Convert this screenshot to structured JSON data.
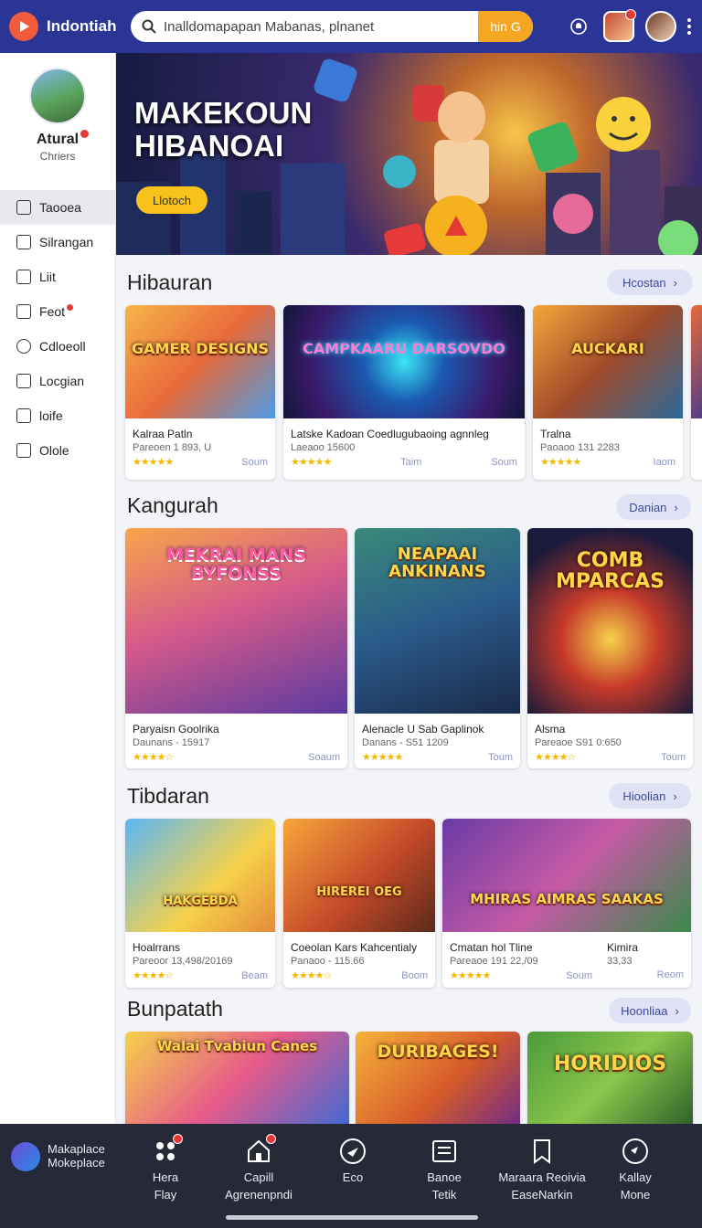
{
  "header": {
    "brand": "Indontiah",
    "search_placeholder": "Inalldomapapan Mabanas, plnanet",
    "search_button": "hin G"
  },
  "sidebar": {
    "profile_name": "Atural",
    "profile_sub": "Chriers",
    "items": [
      {
        "label": "Taooea"
      },
      {
        "label": "Silrangan"
      },
      {
        "label": "Liit"
      },
      {
        "label": "Feot"
      },
      {
        "label": "Cdloeoll"
      },
      {
        "label": "Locgian"
      },
      {
        "label": "loife"
      },
      {
        "label": "Olole"
      }
    ]
  },
  "hero": {
    "title": "MAKEKOUN HIBANOAI",
    "button": "Llotoch"
  },
  "sections": [
    {
      "title": "Hibauran",
      "more": "Hcostan",
      "cards": [
        {
          "image_text": "GAMER DESIGNS",
          "title": "Kalraa Patln",
          "sub": "Pareoen 1 893, U",
          "action": "Soum"
        },
        {
          "image_text": "CAMPKAARU DARSOVDO",
          "title": "Latske Kadoan Coedlugubaoing agnnleg",
          "sub": "Laeaoo 15600",
          "action": "Taim",
          "action2": "Soum"
        },
        {
          "image_text": "AUCKARI",
          "title": "Tralna",
          "sub": "Paoaoo 131 2283",
          "action": "Iaom"
        }
      ]
    },
    {
      "title": "Kangurah",
      "more": "Danian",
      "cards": [
        {
          "image_text": "MEKRAI MANS BYFONSS",
          "title": "Paryaisn Goolrika",
          "sub": "Daunans - 15917",
          "action": "Soaum"
        },
        {
          "image_text": "NEAPAAI ANKINANS",
          "title": "Alenacle U Sab Gaplinok",
          "sub": "Danans - S51 1209",
          "action": "Toum"
        },
        {
          "image_text": "COMB MPARCAS",
          "title": "Alsma",
          "sub": "Pareaoe S91 0:650",
          "action": "Toum"
        }
      ]
    },
    {
      "title": "Tibdaran",
      "more": "Hioolian",
      "cards": [
        {
          "image_text": "HAKGEBDA",
          "title": "Hoalrrans",
          "sub": "Pareoor 13,498/20169",
          "action": "Beam"
        },
        {
          "image_text": "HIREREI OEG",
          "title": "Coeolan Kars Kahcentialy",
          "sub": "Panaoo - 115.66",
          "action": "Boom"
        },
        {
          "image_text": "MHIRAS AIMRAS SAAKAS",
          "title": "Cmatan hol Tline",
          "sub": "Pareaoe 191 22,/09",
          "action": "Soum",
          "title2": "Kimira",
          "sub2": "33,33",
          "action2": "Reom"
        }
      ]
    },
    {
      "title": "Bunpatath",
      "more": "Hoonliaa",
      "cards": [
        {
          "image_text": "Walai Tvabiun Canes"
        },
        {
          "image_text": "DURIBAGES!"
        },
        {
          "image_text": "HORIDIOS"
        }
      ]
    }
  ],
  "bottom_nav": {
    "brand_line1": "Makaplace",
    "brand_line2": "Mokeplace",
    "items": [
      {
        "line1": "Hera",
        "line2": "Flay"
      },
      {
        "line1": "Capill",
        "line2": "Agrenenpndi"
      },
      {
        "line1": "Eco",
        "line2": ""
      },
      {
        "line1": "Banoe",
        "line2": "Tetik"
      },
      {
        "line1": "Maraara Reoivia",
        "line2": "EaseNarkin"
      },
      {
        "line1": "Kallay",
        "line2": "Mone"
      }
    ]
  },
  "colors": {
    "header_bg": "#2a3596",
    "accent": "#f5a623",
    "bottom_nav_bg": "#262a38",
    "badge": "#e53935",
    "star": "#f5b800"
  }
}
